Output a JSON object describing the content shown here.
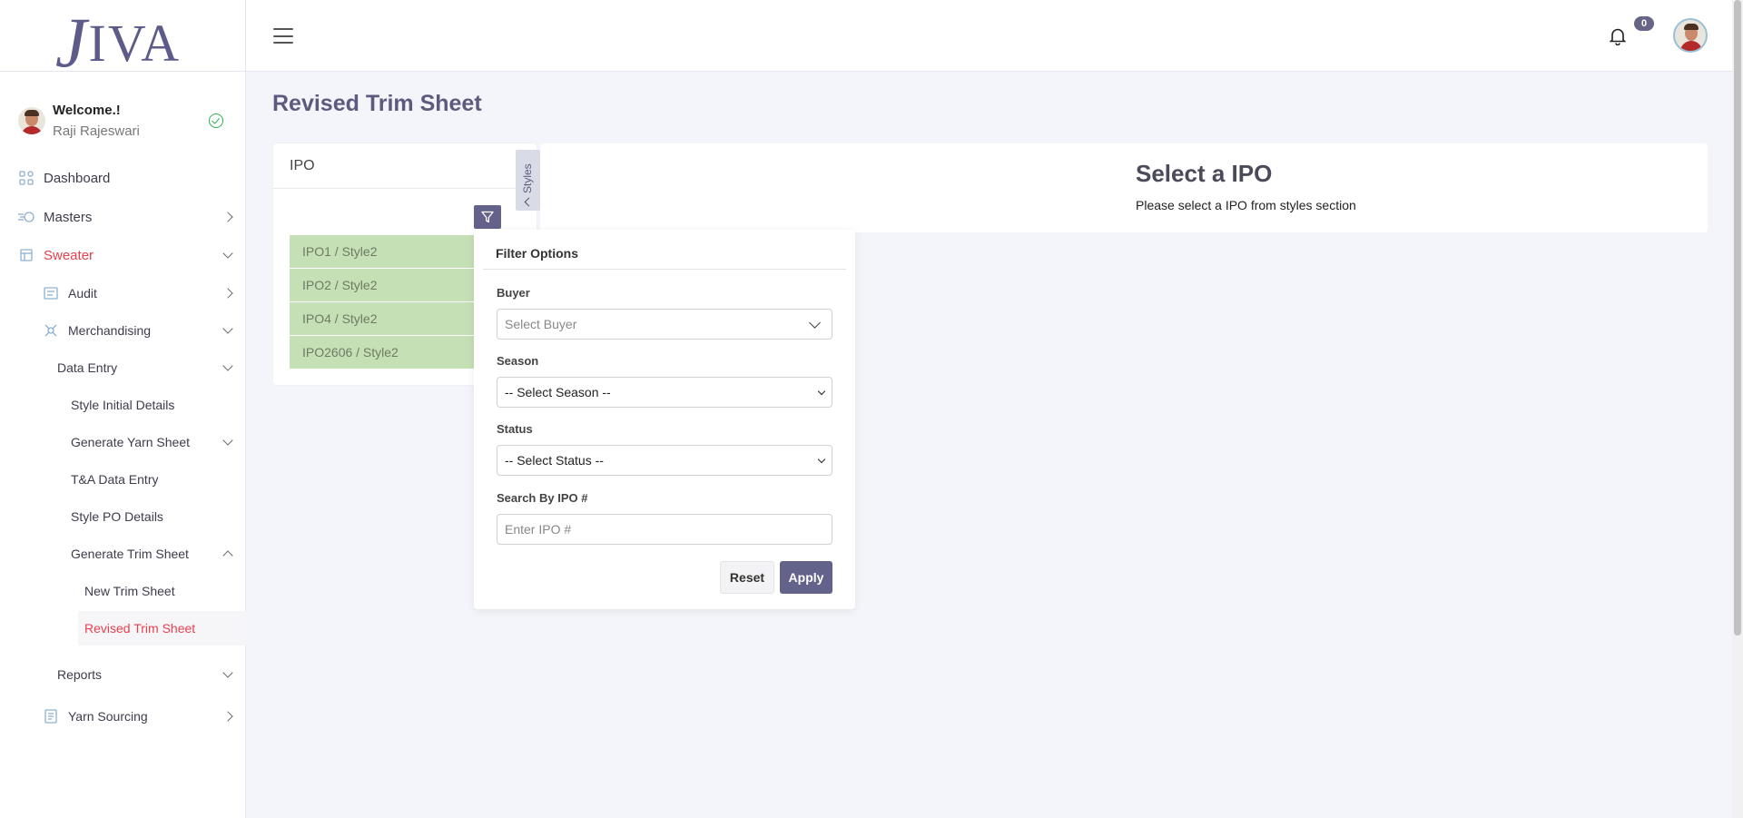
{
  "app": {
    "logo_text": "JIVA"
  },
  "user": {
    "welcome": "Welcome.!",
    "name": "Raji Rajeswari"
  },
  "topbar": {
    "notification_count": "0"
  },
  "sidebar": {
    "dashboard": "Dashboard",
    "masters": "Masters",
    "sweater": "Sweater",
    "audit": "Audit",
    "merchandising": "Merchandising",
    "data_entry": "Data Entry",
    "style_initial_details": "Style Initial Details",
    "generate_yarn_sheet": "Generate Yarn Sheet",
    "ta_data_entry": "T&A Data Entry",
    "style_po_details": "Style PO Details",
    "generate_trim_sheet": "Generate Trim Sheet",
    "new_trim_sheet": "New Trim Sheet",
    "revised_trim_sheet": "Revised Trim Sheet",
    "reports": "Reports",
    "yarn_sourcing": "Yarn Sourcing"
  },
  "page": {
    "title": "Revised Trim Sheet"
  },
  "ipo_panel": {
    "header": "IPO",
    "styles_tab": "Styles",
    "items": [
      "IPO1 / Style2",
      "IPO2 / Style2",
      "IPO4 / Style2",
      "IPO2606 / Style2"
    ]
  },
  "main": {
    "title": "Select a IPO",
    "subtitle": "Please select a IPO from styles section"
  },
  "filter": {
    "title": "Filter Options",
    "buyer_label": "Buyer",
    "buyer_value": "Select Buyer",
    "season_label": "Season",
    "season_value": "-- Select Season --",
    "status_label": "Status",
    "status_value": "-- Select Status --",
    "search_label": "Search By IPO #",
    "search_placeholder": "Enter IPO #",
    "reset": "Reset",
    "apply": "Apply"
  },
  "colors": {
    "accent": "#63628a",
    "active_nav": "#e8404e",
    "ipo_row": "#c5e0b4"
  }
}
